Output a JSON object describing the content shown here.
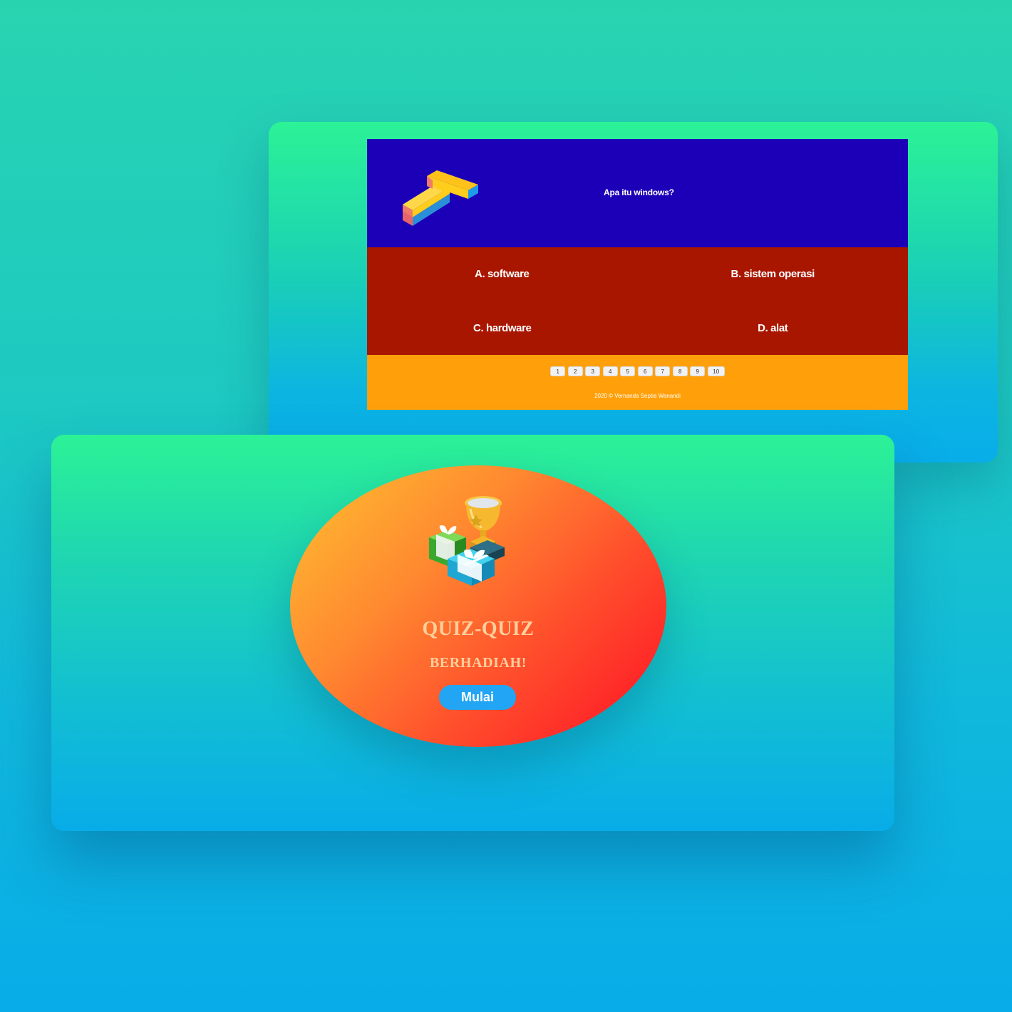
{
  "quiz": {
    "question": "Apa itu windows?",
    "answers": [
      "A. software",
      "B. sistem operasi",
      "C. hardware",
      "D. alat"
    ],
    "pages": [
      "1",
      "2",
      "3",
      "4",
      "5",
      "6",
      "7",
      "8",
      "9",
      "10"
    ],
    "copyright": "2020 © Vernanda Septia Wanandi",
    "colors": {
      "header": "#1c00b8",
      "answers": "#a91600",
      "footer": "#ffa00a"
    },
    "logo_icon": "number-one-3d-icon"
  },
  "start": {
    "title": "QUIZ-QUIZ",
    "subtitle": "BERHADIAH!",
    "button_label": "Mulai",
    "illustration_icon": "trophy-gifts-icon",
    "colors": {
      "button": "#22a5f5",
      "title": "#ffcf9c"
    }
  }
}
